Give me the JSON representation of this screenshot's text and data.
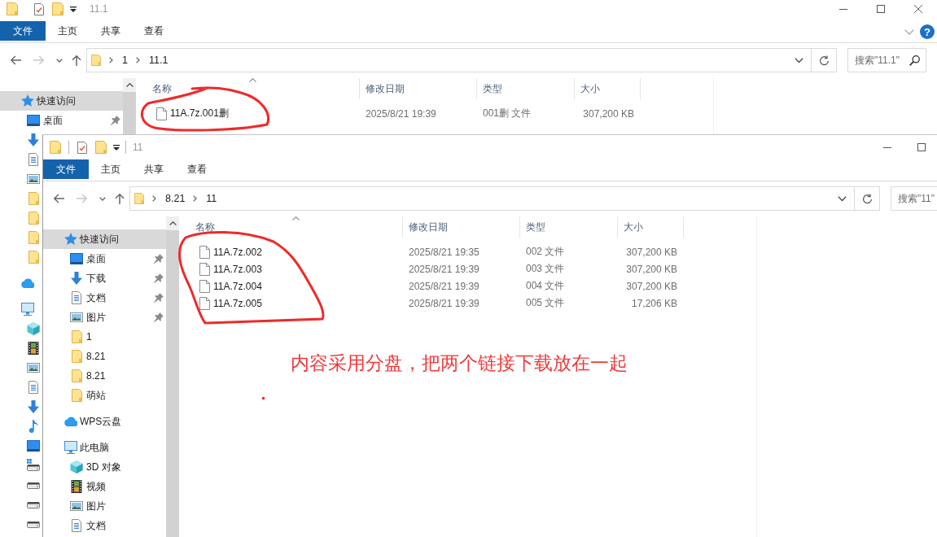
{
  "windows": [
    {
      "title": "11.1",
      "active": false,
      "window_controls": [
        {
          "kind": "minimize"
        },
        {
          "kind": "maximize"
        },
        {
          "kind": "close"
        }
      ],
      "ribbon_tabs": [
        {
          "label": "文件",
          "kind": "file"
        },
        {
          "label": "主页",
          "kind": "tab"
        },
        {
          "label": "共享",
          "kind": "tab"
        },
        {
          "label": "查看",
          "kind": "tab"
        }
      ],
      "ribbon_buttons": [
        {
          "kind": "collapse"
        },
        {
          "kind": "help",
          "label": "?"
        }
      ],
      "nav_buttons": [
        {
          "kind": "back",
          "disabled": false
        },
        {
          "kind": "forward",
          "disabled": true
        },
        {
          "kind": "recent",
          "disabled": false
        },
        {
          "kind": "up",
          "disabled": false
        }
      ],
      "address": {
        "path": [
          "1",
          "11.1"
        ]
      },
      "search": {
        "placeholder": "搜索\"11.1\""
      },
      "sidebar": [
        {
          "label": "快速访问",
          "kind": "star",
          "selected": true,
          "children": [
            {
              "label": "桌面",
              "kind": "desktop",
              "selected": false,
              "pinned": true
            },
            {
              "kind": "download",
              "selected": false
            },
            {
              "kind": "document",
              "selected": false
            },
            {
              "kind": "picture",
              "selected": false
            },
            {
              "kind": "folder",
              "selected": false
            },
            {
              "kind": "folder",
              "selected": false
            },
            {
              "kind": "folder",
              "selected": false
            },
            {
              "kind": "folder",
              "selected": false
            }
          ]
        },
        {
          "kind": "cloud",
          "selected": false
        },
        {
          "kind": "pc",
          "selected": false,
          "children": [
            {
              "kind": "cube",
              "selected": false
            },
            {
              "kind": "video",
              "selected": false
            },
            {
              "kind": "picture",
              "selected": false
            },
            {
              "kind": "document",
              "selected": false
            },
            {
              "kind": "download",
              "selected": false
            },
            {
              "kind": "music",
              "selected": false
            },
            {
              "kind": "desktop",
              "selected": false
            },
            {
              "kind": "sysdrive",
              "selected": false
            },
            {
              "kind": "drive",
              "selected": false
            },
            {
              "kind": "drive",
              "selected": false
            },
            {
              "kind": "drive",
              "selected": false
            }
          ]
        }
      ],
      "columns": [
        {
          "label": "名称",
          "sorted": true
        },
        {
          "label": "修改日期",
          "sorted": false
        },
        {
          "label": "类型",
          "sorted": false
        },
        {
          "label": "大小",
          "sorted": false
        }
      ],
      "files": [
        {
          "name": "11A.7z.001删",
          "modified": "2025/8/21 19:39",
          "type": "001删 文件",
          "size": "307,200 KB"
        }
      ]
    },
    {
      "title": "11",
      "active": true,
      "window_controls": [
        {
          "kind": "minimize"
        },
        {
          "kind": "maximize"
        }
      ],
      "ribbon_tabs": [
        {
          "label": "文件",
          "kind": "file"
        },
        {
          "label": "主页",
          "kind": "tab"
        },
        {
          "label": "共享",
          "kind": "tab"
        },
        {
          "label": "查看",
          "kind": "tab"
        }
      ],
      "nav_buttons": [
        {
          "kind": "back",
          "disabled": false
        },
        {
          "kind": "forward",
          "disabled": true
        },
        {
          "kind": "recent",
          "disabled": false
        },
        {
          "kind": "up",
          "disabled": false
        }
      ],
      "address": {
        "path": [
          "8.21",
          "11"
        ]
      },
      "search": {
        "placeholder": "搜索\"11\""
      },
      "sidebar": [
        {
          "label": "快速访问",
          "kind": "star",
          "selected": true,
          "children": [
            {
              "label": "桌面",
              "kind": "desktop",
              "selected": false,
              "pinned": true
            },
            {
              "label": "下载",
              "kind": "download",
              "selected": false,
              "pinned": true
            },
            {
              "label": "文档",
              "kind": "document",
              "selected": false,
              "pinned": true
            },
            {
              "label": "图片",
              "kind": "picture",
              "selected": false,
              "pinned": true
            },
            {
              "label": "1",
              "kind": "folder",
              "selected": false,
              "pinned": false
            },
            {
              "label": "8.21",
              "kind": "folder",
              "selected": false,
              "pinned": false
            },
            {
              "label": "8.21",
              "kind": "folder",
              "selected": false,
              "pinned": false
            },
            {
              "label": "萌站",
              "kind": "folder",
              "selected": false,
              "pinned": false
            }
          ]
        },
        {
          "label": "WPS云盘",
          "kind": "cloud",
          "selected": false
        },
        {
          "label": "此电脑",
          "kind": "pc",
          "selected": false,
          "children": [
            {
              "label": "3D 对象",
              "kind": "cube",
              "selected": false
            },
            {
              "label": "视频",
              "kind": "video",
              "selected": false
            },
            {
              "label": "图片",
              "kind": "picture",
              "selected": false
            },
            {
              "label": "文档",
              "kind": "document",
              "selected": false
            }
          ]
        }
      ],
      "columns": [
        {
          "label": "名称",
          "sorted": true
        },
        {
          "label": "修改日期",
          "sorted": false
        },
        {
          "label": "类型",
          "sorted": false
        },
        {
          "label": "大小",
          "sorted": false
        }
      ],
      "files": [
        {
          "name": "11A.7z.002",
          "modified": "2025/8/21 19:35",
          "type": "002 文件",
          "size": "307,200 KB"
        },
        {
          "name": "11A.7z.003",
          "modified": "2025/8/21 19:39",
          "type": "003 文件",
          "size": "307,200 KB"
        },
        {
          "name": "11A.7z.004",
          "modified": "2025/8/21 19:39",
          "type": "004 文件",
          "size": "307,200 KB"
        },
        {
          "name": "11A.7z.005",
          "modified": "2025/8/21 19:39",
          "type": "005 文件",
          "size": "17,206 KB"
        }
      ]
    }
  ],
  "annotations": {
    "note": "内容采用分盘，把两个链接下载放在一起"
  }
}
